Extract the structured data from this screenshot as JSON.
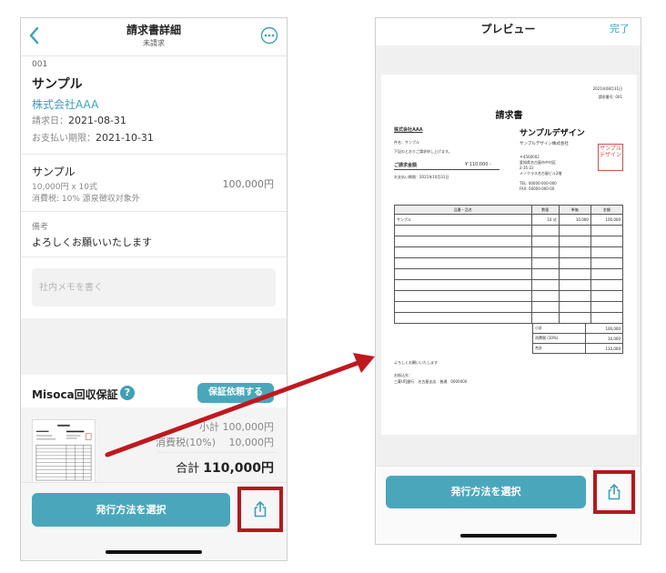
{
  "detail": {
    "header": {
      "title": "請求書詳細",
      "status": "未請求"
    },
    "invoice_no": "001",
    "title": "サンプル",
    "client": "株式会社AAA",
    "invoice_date_label": "請求日：",
    "invoice_date": "2021-08-31",
    "due_label": "お支払い期限：",
    "due_date": "2021-10-31",
    "item": {
      "name": "サンプル",
      "qty": "10,000円 x 10式",
      "tax": "消費税: 10% 源泉徴収対象外",
      "amount": "100,000円"
    },
    "note_label": "備考",
    "note": "よろしくお願いいたします",
    "memo_placeholder": "社内メモを書く",
    "misoca_label": "Misoca回収保証",
    "help_glyph": "?",
    "guarantee_button": "保証依頼する",
    "summary": {
      "subtotal": "小計 100,000円",
      "tax": "消費税(10%)　 10,000円",
      "total_label": "合計",
      "total_value": "110,000円"
    },
    "issue_button": "発行方法を選択"
  },
  "preview": {
    "header": {
      "title": "プレビュー",
      "done": "完了"
    },
    "doc": {
      "date": "2021年08月31日",
      "invoice_no": "請求番号: 001",
      "title": "請求書",
      "client": "株式会社AAA",
      "subject": "件名：サンプル",
      "intro": "下記のとおりご請求申し上げます。",
      "amount_label": "ご請求金額",
      "amount": "¥ 110,000 -",
      "due": "お支払い期限：2021年10月31日",
      "logo": "サンプルデザイン",
      "company": "サンプルデザイン株式会社",
      "addr1": "〒4560002",
      "addr2": "愛知県名古屋市中村区",
      "addr3": "2-35-22",
      "addr4": "メゾクラス名古屋ビル2階",
      "tel": "TEL: 00000-000-000",
      "fax": "FAX: 00000-000-00",
      "stamp": "サンプルデザイン",
      "columns": [
        "品番・品名",
        "数量",
        "単価",
        "金額"
      ],
      "rows": [
        [
          "サンプル",
          "10 式",
          "10,000",
          "100,000"
        ]
      ],
      "sum_rows": [
        [
          "小計",
          "100,000"
        ],
        [
          "消費税 (10%)",
          "10,000"
        ],
        [
          "合計",
          "110,000"
        ]
      ],
      "note": "よろしくお願いいたします",
      "bank_label": "お振込先：",
      "bank": "三菱UFJ銀行　名古屋支店　普通　0000000"
    },
    "issue_button": "発行方法を選択"
  },
  "colors": {
    "accent": "#4aa7bb",
    "highlight": "#b3191f",
    "link": "#3ea0b6"
  }
}
